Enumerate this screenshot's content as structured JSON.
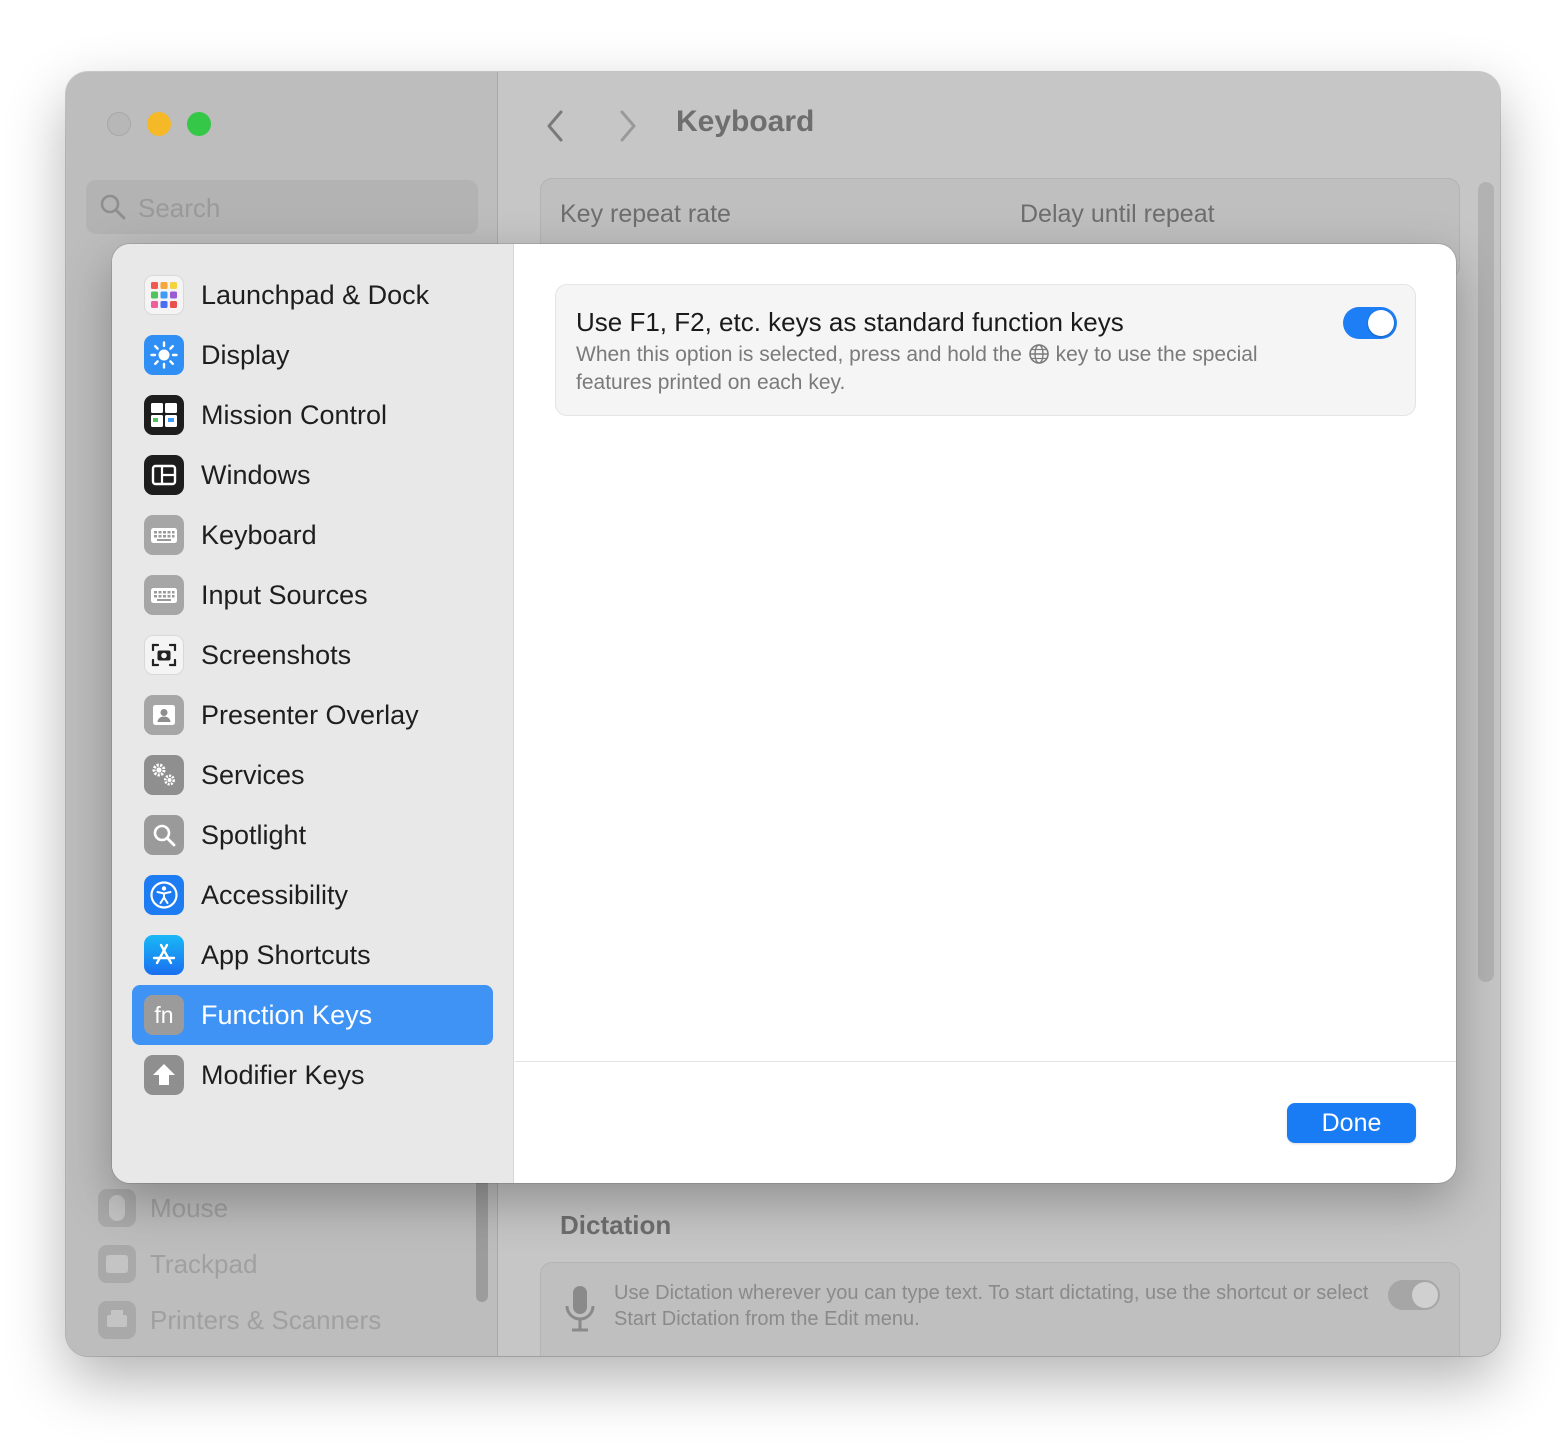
{
  "window": {
    "title": "Keyboard",
    "search_placeholder": "Search"
  },
  "background_sidebar": {
    "items": [
      {
        "label": "Mouse",
        "icon": "mouse-icon"
      },
      {
        "label": "Trackpad",
        "icon": "trackpad-icon"
      },
      {
        "label": "Printers & Scanners",
        "icon": "printer-icon"
      }
    ]
  },
  "background_main": {
    "key_repeat_rate": "Key repeat rate",
    "delay_until_repeat": "Delay until repeat",
    "dictation_title": "Dictation",
    "dictation_desc": "Use Dictation wherever you can type text. To start dictating, use the shortcut or select Start Dictation from the Edit menu."
  },
  "sheet": {
    "sidebar": {
      "items": [
        {
          "label": "Launchpad & Dock",
          "icon": "launchpad-icon",
          "selected": false
        },
        {
          "label": "Display",
          "icon": "display-brightness-icon",
          "selected": false
        },
        {
          "label": "Mission Control",
          "icon": "mission-control-icon",
          "selected": false
        },
        {
          "label": "Windows",
          "icon": "windows-icon",
          "selected": false
        },
        {
          "label": "Keyboard",
          "icon": "keyboard-icon",
          "selected": false
        },
        {
          "label": "Input Sources",
          "icon": "input-sources-icon",
          "selected": false
        },
        {
          "label": "Screenshots",
          "icon": "screenshot-icon",
          "selected": false
        },
        {
          "label": "Presenter Overlay",
          "icon": "presenter-overlay-icon",
          "selected": false
        },
        {
          "label": "Services",
          "icon": "gears-icon",
          "selected": false
        },
        {
          "label": "Spotlight",
          "icon": "spotlight-icon",
          "selected": false
        },
        {
          "label": "Accessibility",
          "icon": "accessibility-icon",
          "selected": false
        },
        {
          "label": "App Shortcuts",
          "icon": "app-store-icon",
          "selected": false
        },
        {
          "label": "Function Keys",
          "icon": "fn-key-icon",
          "selected": true
        },
        {
          "label": "Modifier Keys",
          "icon": "modifier-arrow-icon",
          "selected": false
        }
      ]
    },
    "option": {
      "title": "Use F1, F2, etc. keys as standard function keys",
      "desc_before": "When this option is selected, press and hold the",
      "desc_after": "key to use the special features printed on each key.",
      "enabled": true
    },
    "done_label": "Done"
  },
  "colors": {
    "accent": "#1a7cf4",
    "selection": "#3f93f5",
    "close": "#b7b7b7",
    "minimize": "#f5b827",
    "maximize": "#34c748"
  }
}
